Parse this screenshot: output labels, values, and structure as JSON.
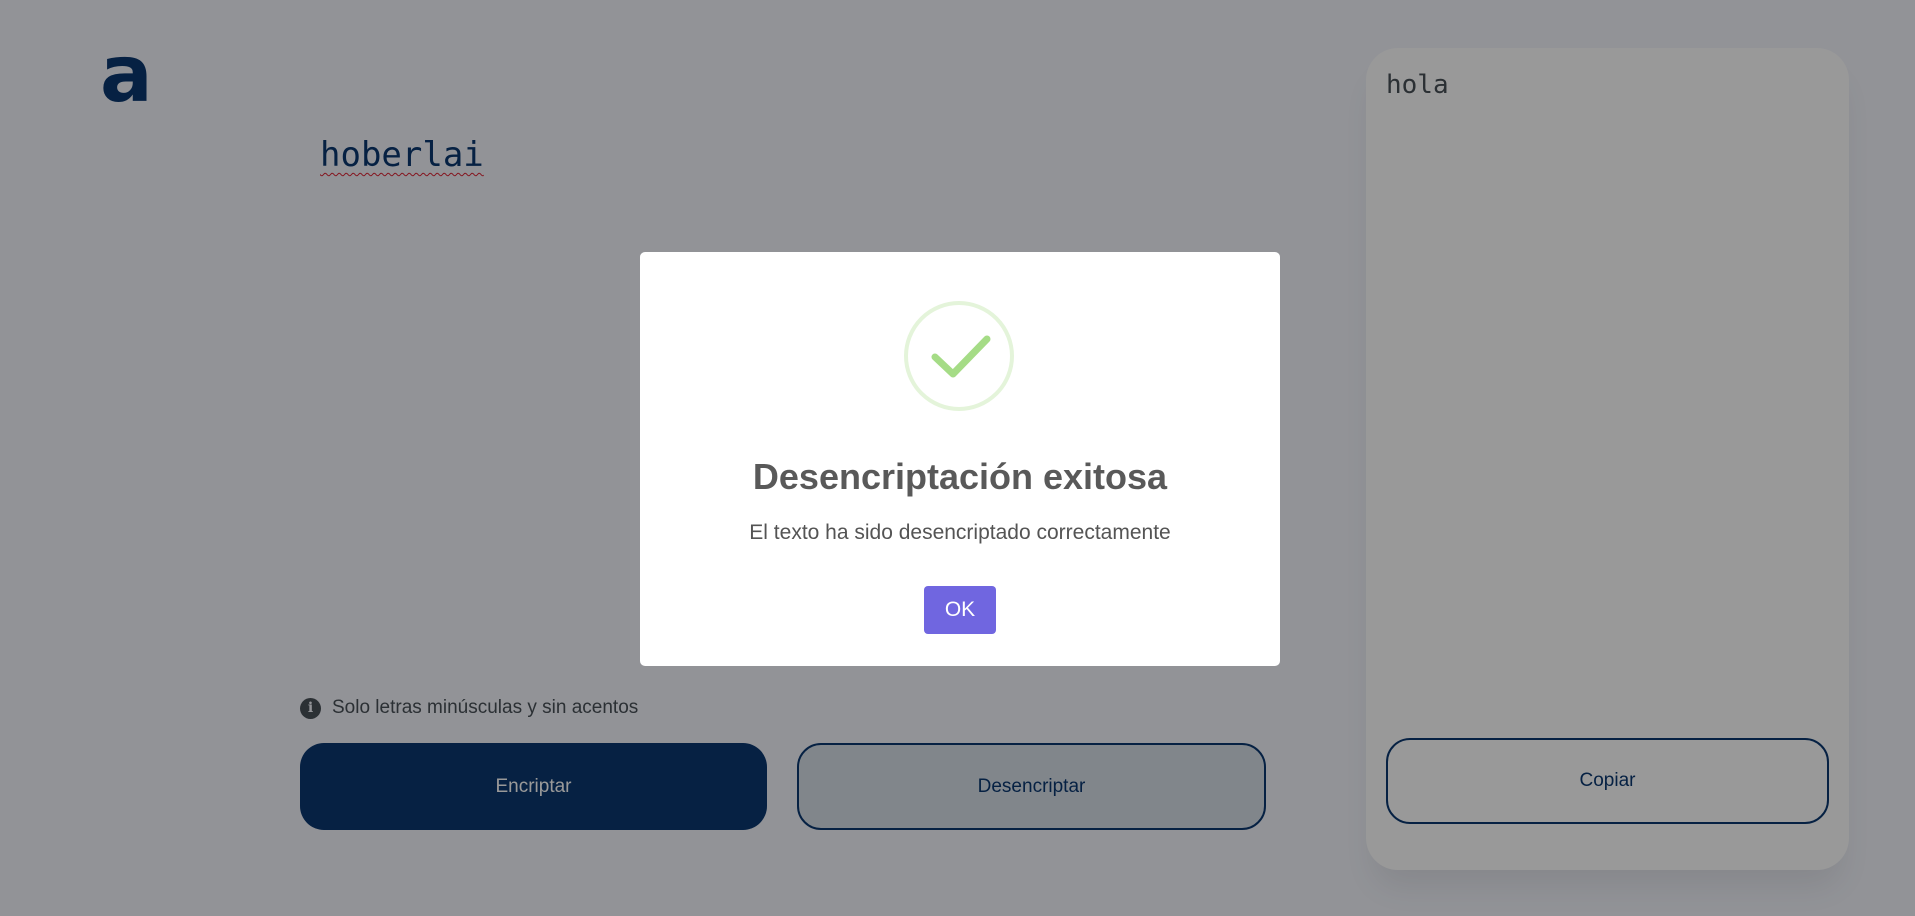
{
  "app": {
    "logo_text": "a"
  },
  "editor": {
    "input_value": "hoberlai"
  },
  "hint": {
    "icon": "info-icon",
    "text": "Solo letras minúsculas y sin acentos"
  },
  "actions": {
    "encrypt_label": "Encriptar",
    "decrypt_label": "Desencriptar"
  },
  "output": {
    "text": "hola",
    "copy_label": "Copiar"
  },
  "dialog": {
    "icon": "success-check-icon",
    "title": "Desencriptación exitosa",
    "message": "El texto ha sido desencriptado correctamente",
    "ok_label": "OK"
  },
  "colors": {
    "brand": "#0a3871",
    "confirm": "#7066e0",
    "success": "#a5dc86"
  }
}
